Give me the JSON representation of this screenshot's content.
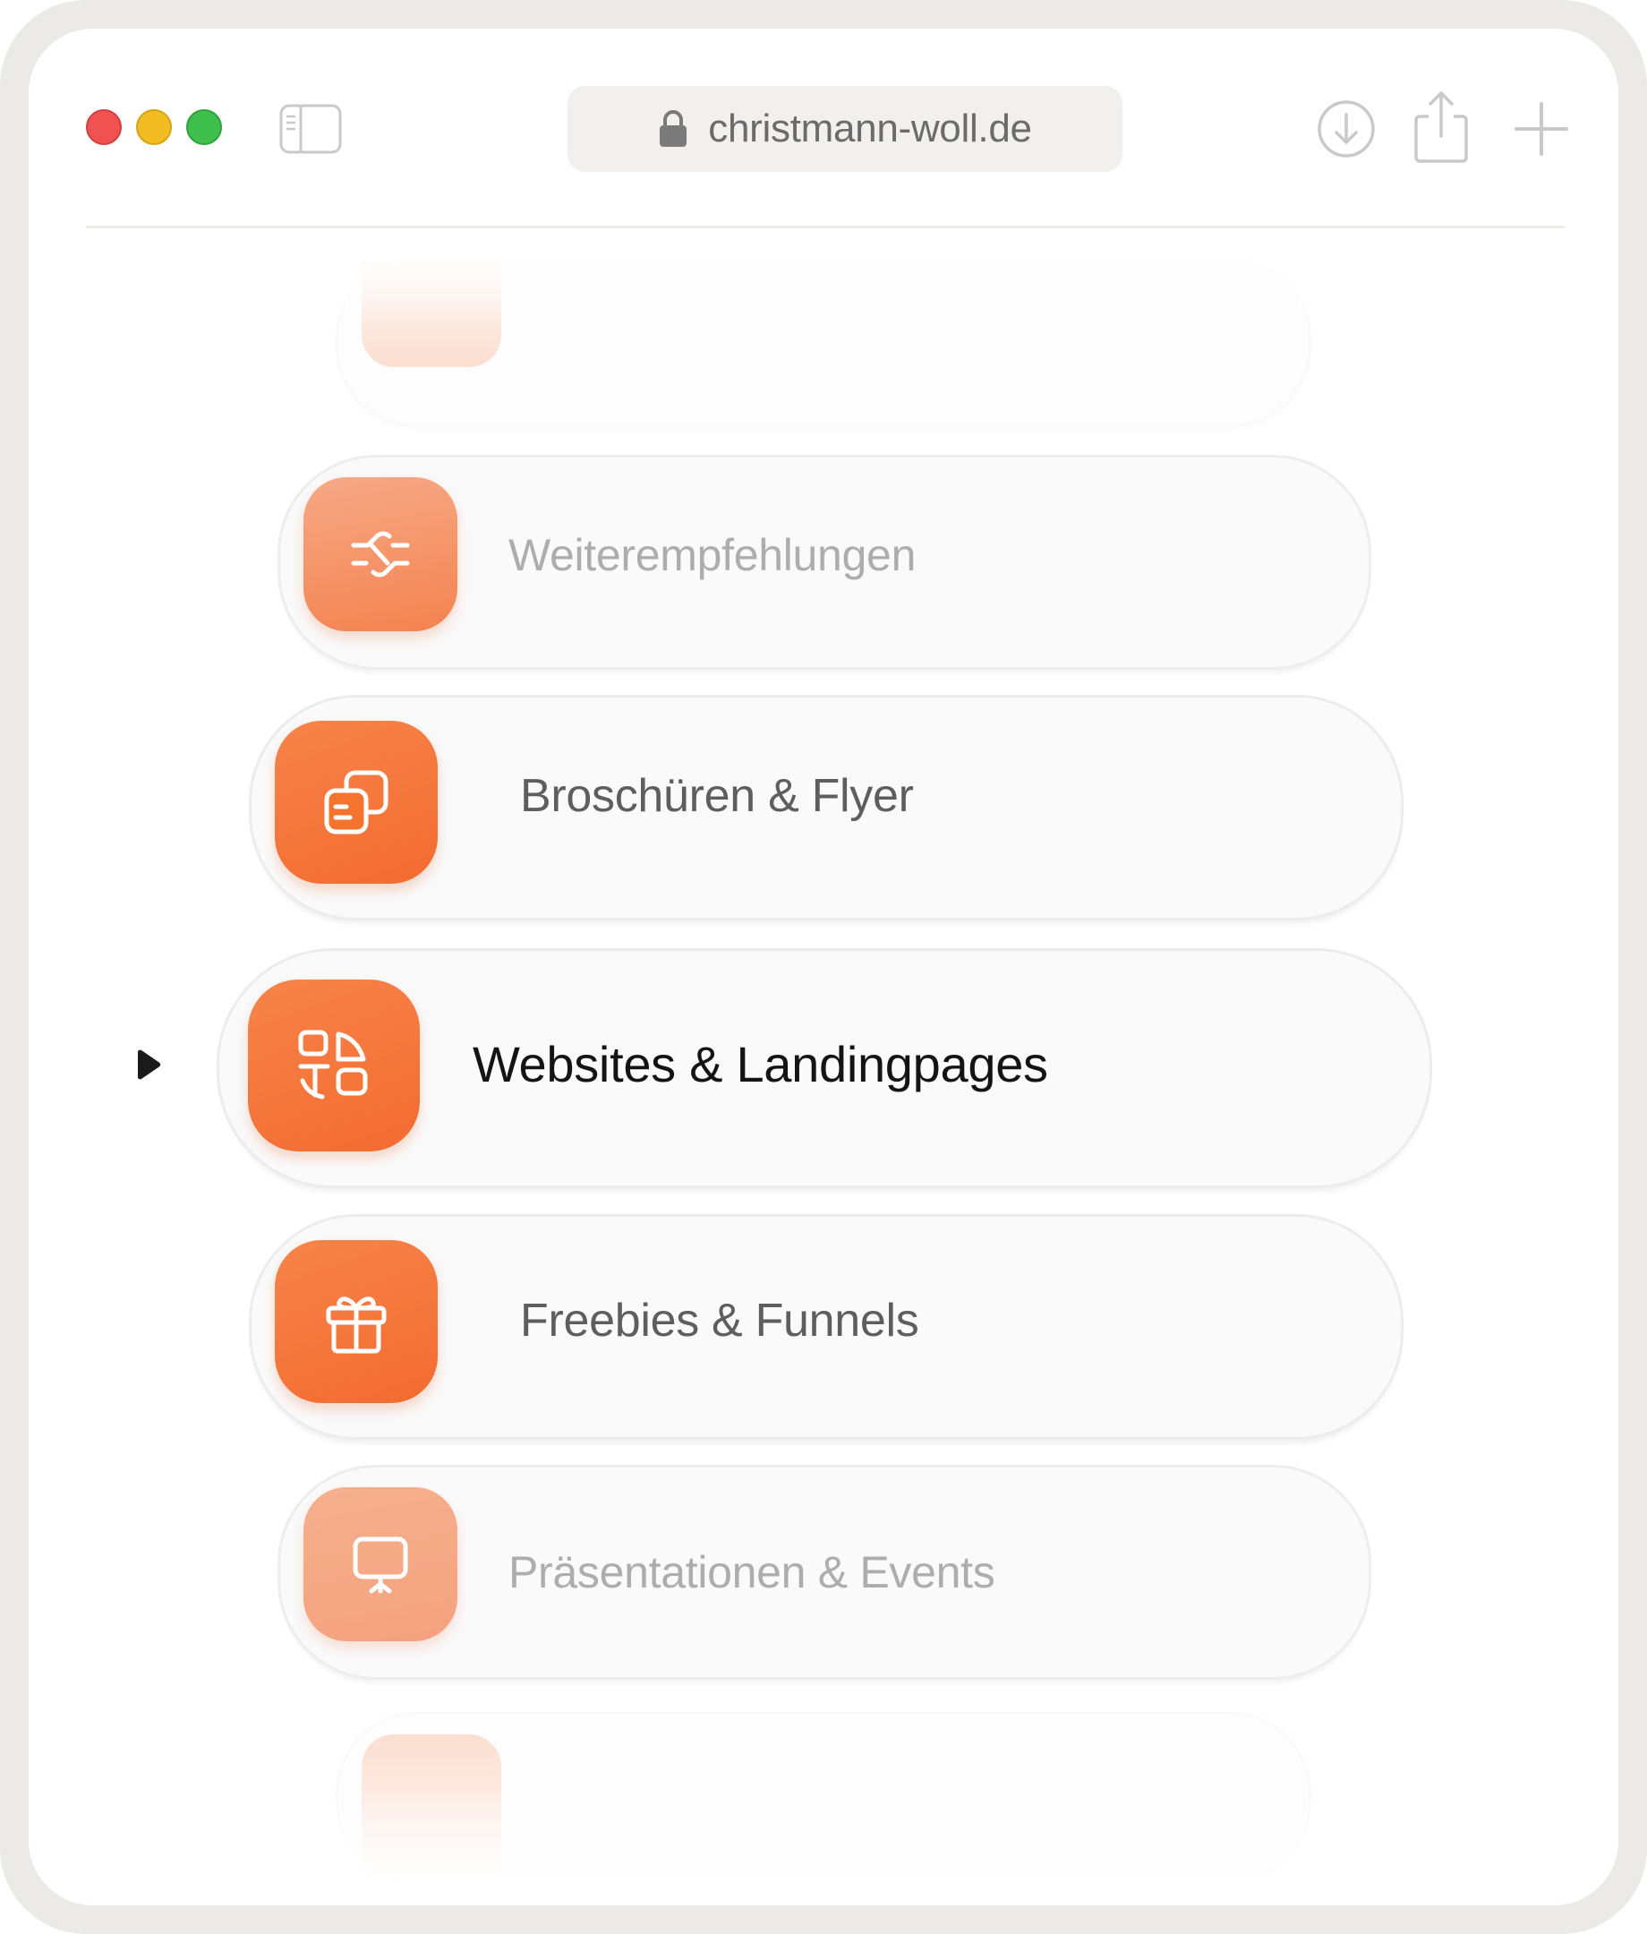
{
  "browser": {
    "url": "christmann-woll.de",
    "icons": {
      "lock": "lock-icon",
      "sidebar": "sidebar-icon",
      "download": "download-icon",
      "share": "share-icon",
      "new_tab": "plus-icon"
    }
  },
  "menu": {
    "accent_color": "#f36b30",
    "items": [
      {
        "label": "",
        "icon": "",
        "state": "faded"
      },
      {
        "label": "Weiterempfehlungen",
        "icon": "handshake-icon",
        "state": "dim"
      },
      {
        "label": "Broschüren & Flyer",
        "icon": "documents-icon",
        "state": "normal"
      },
      {
        "label": "Websites & Landingpages",
        "icon": "web-layout-icon",
        "state": "active"
      },
      {
        "label": "Freebies & Funnels",
        "icon": "gift-icon",
        "state": "normal"
      },
      {
        "label": "Präsentationen & Events",
        "icon": "presentation-icon",
        "state": "dim"
      },
      {
        "label": "",
        "icon": "",
        "state": "faded"
      }
    ]
  }
}
